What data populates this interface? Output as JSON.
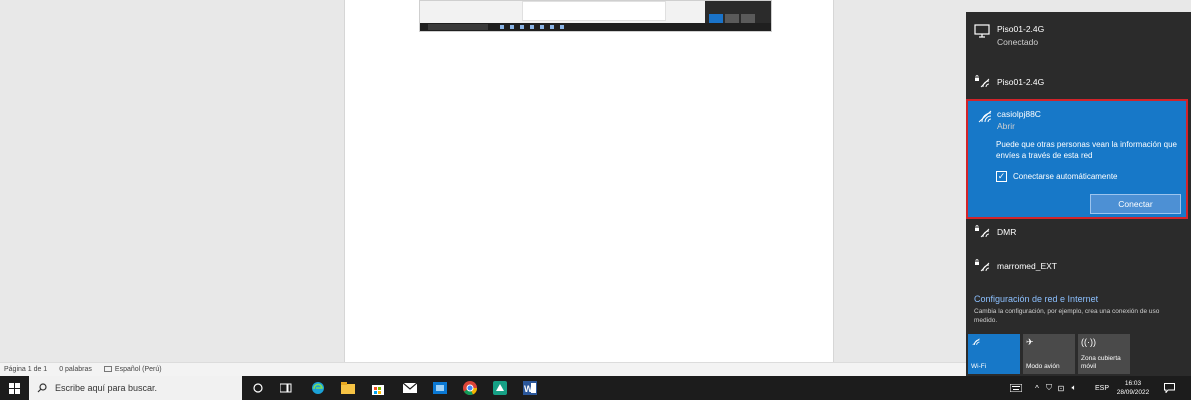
{
  "word_status": {
    "page": "Página 1 de 1",
    "words": "0 palabras",
    "language": "Español (Perú)"
  },
  "network_flyout": {
    "connected": {
      "name": "Piso01-2.4G",
      "status": "Conectado",
      "icon": "monitor-network-icon"
    },
    "networks": [
      {
        "name": "Piso01-2.4G",
        "icon": "wifi-secured-icon"
      },
      {
        "name": "DMR",
        "icon": "wifi-secured-icon"
      },
      {
        "name": "marromed_EXT",
        "icon": "wifi-secured-icon"
      }
    ],
    "selected": {
      "name": "casiolpj88C",
      "status": "Abrir",
      "warning": "Puede que otras personas vean la información que envíes a través de esta red",
      "auto_connect_label": "Conectarse automáticamente",
      "auto_connect_checked": true,
      "connect_button": "Conectar"
    },
    "settings_title": "Configuración de red e Internet",
    "settings_desc": "Cambia la configuración, por ejemplo, crea una conexión de uso medido.",
    "quick_tiles": [
      {
        "label": "Wi-Fi",
        "active": true,
        "icon": "wifi-icon"
      },
      {
        "label": "Modo avión",
        "active": false,
        "icon": "airplane-icon"
      },
      {
        "label": "Zona cubierta móvil",
        "active": false,
        "icon": "hotspot-icon"
      }
    ]
  },
  "taskbar": {
    "search_placeholder": "Escribe aquí para buscar.",
    "language": "ESP",
    "time": "16:03",
    "date": "28/09/2022"
  },
  "colors": {
    "accent": "#1778c8",
    "highlight_border": "#d2232a",
    "flyout_bg": "#2b2b2b",
    "taskbar_bg": "#1c1c1c"
  }
}
